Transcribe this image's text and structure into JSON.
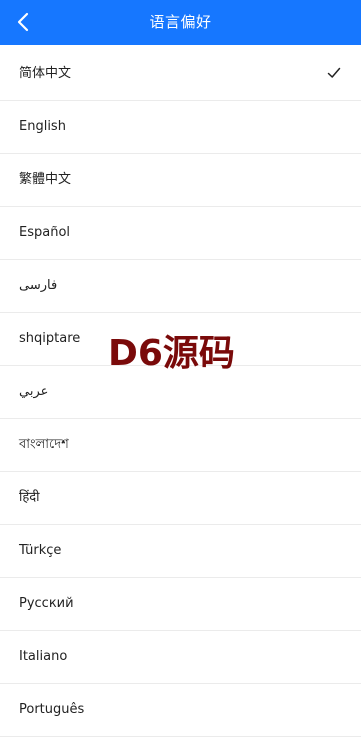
{
  "header": {
    "title": "语言偏好",
    "back_icon": "chevron-left-icon",
    "background_color": "#1677ff"
  },
  "languages": [
    {
      "label": "简体中文",
      "selected": true
    },
    {
      "label": "English",
      "selected": false
    },
    {
      "label": "繁體中文",
      "selected": false
    },
    {
      "label": "Español",
      "selected": false
    },
    {
      "label": "فارسی",
      "selected": false
    },
    {
      "label": "shqiptare",
      "selected": false
    },
    {
      "label": "عربي",
      "selected": false
    },
    {
      "label": "বাংলাদেশ",
      "selected": false
    },
    {
      "label": "हिंदी",
      "selected": false
    },
    {
      "label": "Türkçe",
      "selected": false
    },
    {
      "label": "Русский",
      "selected": false
    },
    {
      "label": "Italiano",
      "selected": false
    },
    {
      "label": "Português",
      "selected": false
    }
  ],
  "selected_icon": "check-icon",
  "watermark": {
    "text": "D6源码",
    "color": "#7a0a0a"
  }
}
